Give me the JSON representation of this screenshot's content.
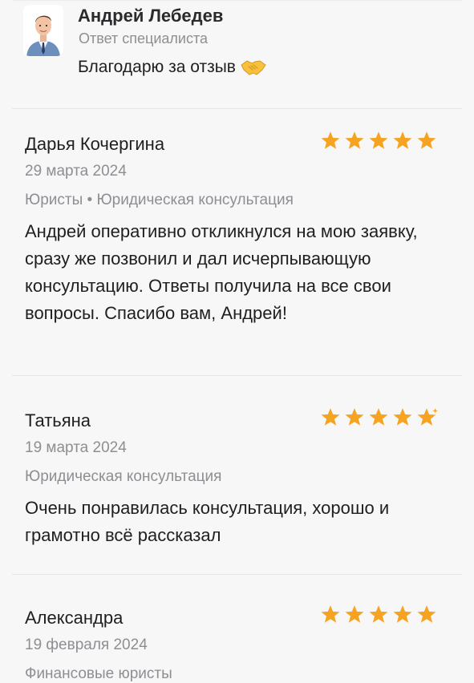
{
  "reply": {
    "name": "Андрей Лебедев",
    "role": "Ответ специалиста",
    "text": "Благодарю за отзыв",
    "emoji_icon": "handshake-icon"
  },
  "reviews": [
    {
      "author": "Дарья Кочергина",
      "date": "29 марта 2024",
      "categories": "Юристы • Юридическая консультация",
      "body": "Андрей оперативно откликнулся на мою заявку, сразу же позвонил и дал исчерпывающую консультацию. Ответы получила на все свои вопросы. Спасибо вам, Андрей!",
      "rating": 5
    },
    {
      "author": "Татьяна",
      "date": "19 марта 2024",
      "categories": "Юридическая консультация",
      "body": "Очень понравилась консультация, хорошо и грамотно всё рассказал",
      "rating": 4.5
    },
    {
      "author": "Александра",
      "date": "19 февраля 2024",
      "categories": "Финансовые юристы",
      "body": "",
      "rating": 5
    }
  ],
  "colors": {
    "star": "#f6a321",
    "muted": "#8e8e93",
    "text": "#1f1f1f",
    "background": "#f7f7f8"
  }
}
